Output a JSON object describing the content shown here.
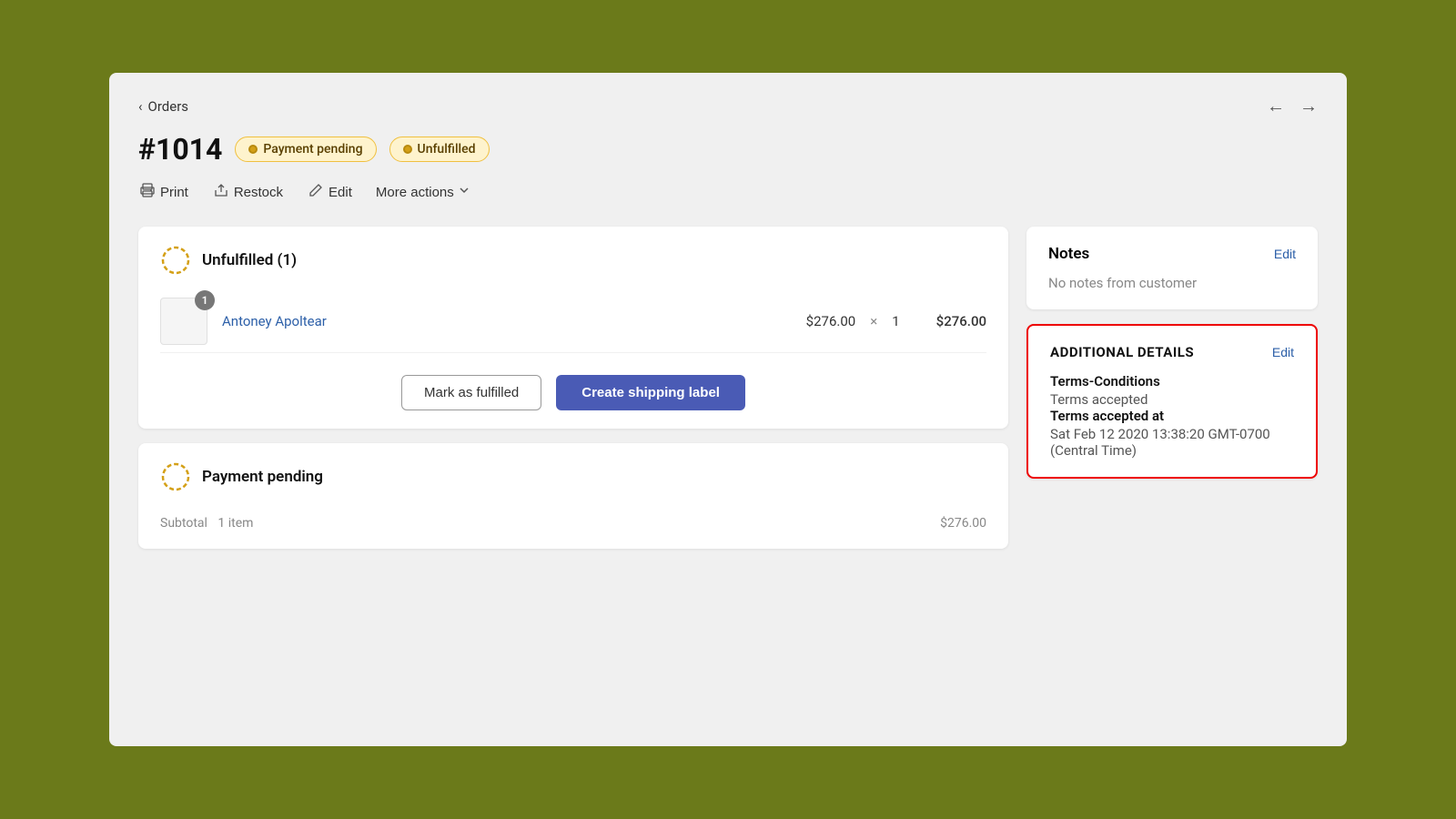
{
  "nav": {
    "back_label": "Orders",
    "arrow_left": "←",
    "arrow_right": "→"
  },
  "order": {
    "number": "#1014",
    "badge_payment": "Payment pending",
    "badge_unfulfilled": "Unfulfilled"
  },
  "actions": {
    "print": "Print",
    "restock": "Restock",
    "edit": "Edit",
    "more_actions": "More actions"
  },
  "unfulfilled_card": {
    "title": "Unfulfilled (1)",
    "product_name": "Antoney Apoltear",
    "unit_price": "$276.00",
    "times": "×",
    "quantity": "1",
    "total": "$276.00",
    "qty_badge": "1",
    "mark_fulfilled_label": "Mark as fulfilled",
    "create_label_label": "Create shipping label"
  },
  "payment_card": {
    "title": "Payment pending",
    "subtotal_label": "Subtotal",
    "subtotal_items": "1 item",
    "subtotal_value": "$276.00"
  },
  "notes": {
    "title": "Notes",
    "edit_label": "Edit",
    "empty_text": "No notes from customer"
  },
  "additional_details": {
    "section_title": "ADDITIONAL DETAILS",
    "edit_label": "Edit",
    "terms_label": "Terms-Conditions",
    "terms_value": "Terms accepted",
    "terms_at_label": "Terms accepted at",
    "terms_at_value": "Sat Feb 12 2020 13:38:20 GMT-0700 (Central Time)"
  }
}
